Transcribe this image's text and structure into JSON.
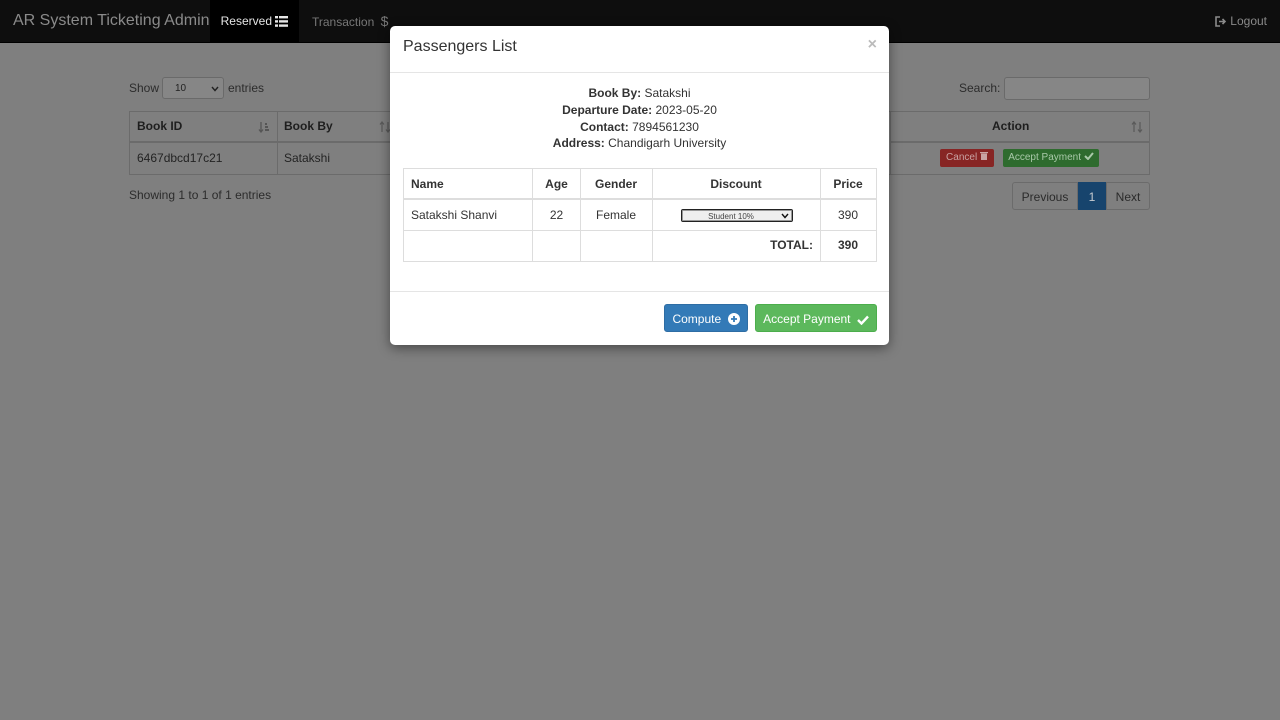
{
  "navbar": {
    "brand": "AR System Ticketing Admin",
    "reserved": "Reserved",
    "transaction": "Transaction",
    "logout": "Logout"
  },
  "list": {
    "show_label": "Show",
    "entries_label": "entries",
    "page_size": "10",
    "search_label": "Search:",
    "columns": [
      "Book ID",
      "Book By",
      "Action"
    ],
    "rows": [
      {
        "book_id": "6467dbcd17c21",
        "book_by": "Satakshi",
        "cancel": "Cancel",
        "accept": "Accept Payment"
      }
    ],
    "info": "Showing 1 to 1 of 1 entries",
    "pager": {
      "prev": "Previous",
      "current": "1",
      "next": "Next"
    }
  },
  "modal": {
    "title": "Passengers List",
    "close": "×",
    "book_by_label": "Book By:",
    "book_by": "Satakshi",
    "departure_label": "Departure Date:",
    "departure": "2023-05-20",
    "contact_label": "Contact:",
    "contact": "7894561230",
    "address_label": "Address:",
    "address": "Chandigarh University",
    "columns": [
      "Name",
      "Age",
      "Gender",
      "Discount",
      "Price"
    ],
    "passenger": {
      "name": "Satakshi Shanvi",
      "age": "22",
      "gender": "Female",
      "discount": "Student 10%",
      "price": "390"
    },
    "total_label": "TOTAL:",
    "total": "390",
    "compute": "Compute",
    "accept": "Accept Payment"
  }
}
